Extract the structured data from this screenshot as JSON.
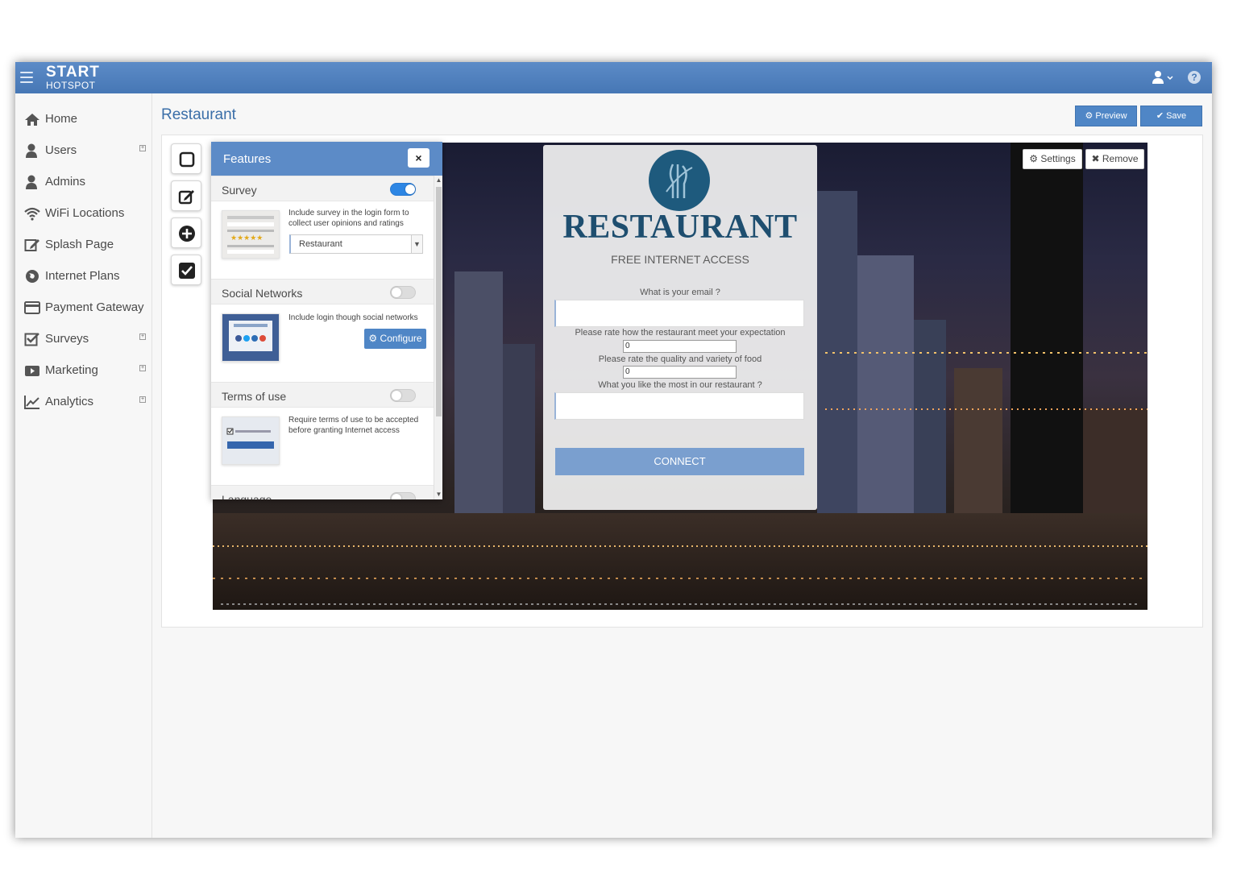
{
  "brand": {
    "line1": "START",
    "line2": "HOTSPOT"
  },
  "sidebar": {
    "items": [
      {
        "label": "Home",
        "icon": "home-icon",
        "expandable": false
      },
      {
        "label": "Users",
        "icon": "user-icon",
        "expandable": true
      },
      {
        "label": "Admins",
        "icon": "user-icon",
        "expandable": false
      },
      {
        "label": "WiFi Locations",
        "icon": "wifi-icon",
        "expandable": false
      },
      {
        "label": "Splash Page",
        "icon": "edit-icon",
        "expandable": false
      },
      {
        "label": "Internet Plans",
        "icon": "globe-icon",
        "expandable": false
      },
      {
        "label": "Payment Gateway",
        "icon": "credit-card-icon",
        "expandable": false
      },
      {
        "label": "Surveys",
        "icon": "checkbox-icon",
        "expandable": true
      },
      {
        "label": "Marketing",
        "icon": "video-icon",
        "expandable": true
      },
      {
        "label": "Analytics",
        "icon": "chart-icon",
        "expandable": true
      }
    ],
    "expand_symbol": "+"
  },
  "main": {
    "title": "Restaurant",
    "preview_label": "Preview",
    "save_label": "Save"
  },
  "tools": [
    "square-icon",
    "edit-icon",
    "plus-circle-icon",
    "check-square-icon"
  ],
  "features": {
    "title": "Features",
    "close": "×",
    "sections": [
      {
        "title": "Survey",
        "enabled": true,
        "description": "Include survey in the login form to collect user opinions and ratings",
        "select_value": "Restaurant"
      },
      {
        "title": "Social Networks",
        "enabled": false,
        "description": "Include login though social networks",
        "button": "Configure"
      },
      {
        "title": "Terms of use",
        "enabled": false,
        "description": "Require terms of use to be accepted before granting Internet access"
      },
      {
        "title": "Language",
        "enabled": false
      }
    ]
  },
  "preview": {
    "settings_label": "Settings",
    "remove_label": "Remove",
    "brand_title": "RESTAURANT",
    "subtitle": "FREE INTERNET ACCESS",
    "q_email": "What is your email ?",
    "q_rate_expectation": "Please rate how the restaurant meet your expectation",
    "rate_expectation_value": "0",
    "q_rate_food": "Please rate the quality and variety of food",
    "rate_food_value": "0",
    "q_like_most": "What you like the most in our restaurant ?",
    "connect_label": "CONNECT"
  },
  "colors": {
    "accent": "#4f86c6",
    "topbar": "#5c8bc7",
    "toggle_on": "#2d86e4",
    "brand_dark": "#1e4e6f"
  }
}
